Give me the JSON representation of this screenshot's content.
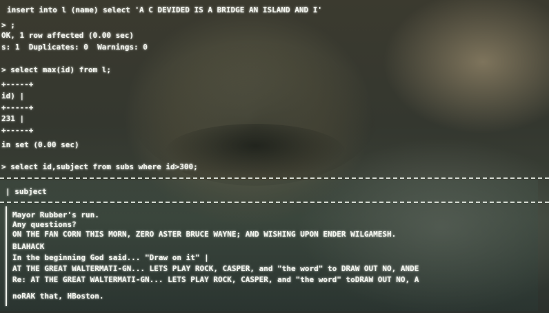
{
  "terminal": {
    "lines": {
      "insert_cmd": "insert into l (name) select 'A C DEVIDED IS A BRIDGE AN ISLAND AND I'",
      "insert_cont": "> ;",
      "query_ok": "OK, 1 row affected (0.00 sec)",
      "records": "s: 1  Duplicates: 0  Warnings: 0",
      "select_max": "> select max(id) from l;",
      "sep1": "+-----+",
      "col_id": "id) |",
      "sep2": "+-----+",
      "val_id": "231 |",
      "sep3": "+-----+",
      "rows_in_set": "in set (0.00 sec)",
      "select_subject": "> select id,subject from subs where id>300;"
    },
    "result_table": {
      "header": "| subject",
      "rows": [
        "Mayor Rubber's run.",
        "Any questions?",
        "ON THE FAN CORN THIS MORN, ZERO ASTER BRUCE WAYNE; AND WISHING UPON ENDER WILGAMESH.",
        "BLAHACK",
        "In the beginning God said... \"Draw on it\" |",
        "AT THE GREAT WALTERMATI-GN... LETS PLAY ROCK, CASPER, and \"the word\" to DRAW OUT NO, ANDE",
        "Re: AT THE GREAT WALTERMATI-GN... LETS PLAY ROCK, CASPER, and \"the word\" toDRAW OUT NO, A",
        "noRAK that, HBoston."
      ]
    }
  }
}
